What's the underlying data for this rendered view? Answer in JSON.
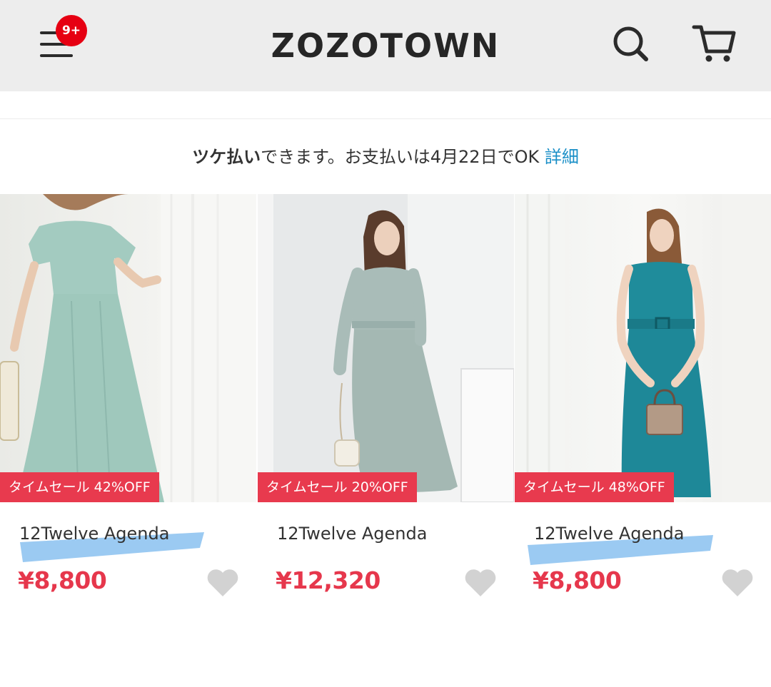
{
  "header": {
    "menu_badge": "9+",
    "logo": "ZOZOTOWN",
    "icons": [
      "menu-icon",
      "search-icon",
      "cart-icon"
    ]
  },
  "notice": {
    "strong": "ツケ払い",
    "text": "できます。お支払いは4月22日でOK",
    "link": "詳細"
  },
  "products": [
    {
      "sale_label": "タイムセール 42%OFF",
      "brand": "12Twelve Agenda",
      "price": "¥8,800",
      "highlighted": true
    },
    {
      "sale_label": "タイムセール 20%OFF",
      "brand": "12Twelve Agenda",
      "price": "¥12,320",
      "highlighted": false
    },
    {
      "sale_label": "タイムセール 48%OFF",
      "brand": "12Twelve Agenda",
      "price": "¥8,800",
      "highlighted": true
    }
  ],
  "colors": {
    "header_bg": "#ededed",
    "badge": "#e60012",
    "sale_tag": "#e83a4e",
    "price": "#e6374c",
    "link": "#1a8fc7",
    "highlight": "#7ab8ee",
    "favorite_icon": "#d2d2d2"
  }
}
